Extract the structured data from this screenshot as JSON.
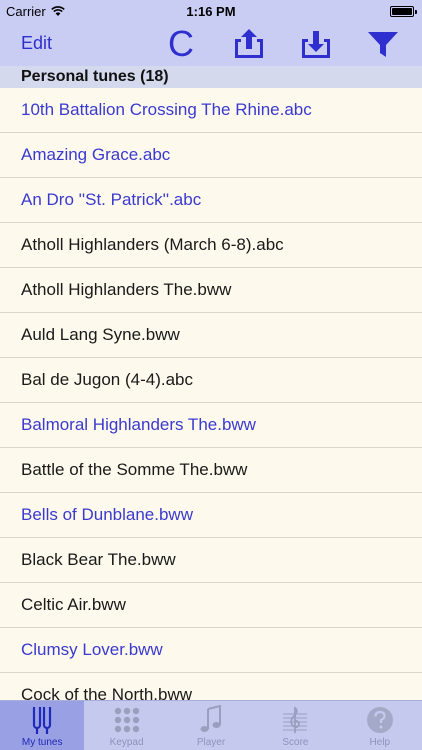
{
  "status_bar": {
    "carrier": "Carrier",
    "time": "1:16 PM"
  },
  "nav": {
    "edit_label": "Edit",
    "c_label": "C",
    "icons": [
      "upload-icon",
      "download-icon",
      "filter-icon"
    ]
  },
  "section": {
    "title": "Personal tunes (18)"
  },
  "tunes": [
    {
      "name": "10th Battalion Crossing The Rhine.abc",
      "color": "#3a3ad0"
    },
    {
      "name": "Amazing Grace.abc",
      "color": "#3a3ad0"
    },
    {
      "name": "An Dro ''St. Patrick''.abc",
      "color": "#3a3ad0"
    },
    {
      "name": "Atholl Highlanders (March 6-8).abc",
      "color": "#1a1a1a"
    },
    {
      "name": "Atholl Highlanders The.bww",
      "color": "#1a1a1a"
    },
    {
      "name": "Auld Lang Syne.bww",
      "color": "#1a1a1a"
    },
    {
      "name": "Bal de Jugon (4-4).abc",
      "color": "#1a1a1a"
    },
    {
      "name": "Balmoral Highlanders The.bww",
      "color": "#3a3ad0"
    },
    {
      "name": "Battle of the Somme The.bww",
      "color": "#1a1a1a"
    },
    {
      "name": "Bells of Dunblane.bww",
      "color": "#3a3ad0"
    },
    {
      "name": "Black Bear The.bww",
      "color": "#1a1a1a"
    },
    {
      "name": "Celtic Air.bww",
      "color": "#1a1a1a"
    },
    {
      "name": "Clumsy Lover.bww",
      "color": "#3a3ad0"
    },
    {
      "name": "Cock of the North.bww",
      "color": "#1a1a1a"
    }
  ],
  "tabs": [
    {
      "label": "My tunes",
      "icon": "tuning-fork-icon",
      "active": true
    },
    {
      "label": "Keypad",
      "icon": "keypad-icon",
      "active": false
    },
    {
      "label": "Player",
      "icon": "music-note-icon",
      "active": false
    },
    {
      "label": "Score",
      "icon": "treble-clef-icon",
      "active": false
    },
    {
      "label": "Help",
      "icon": "help-icon",
      "active": false
    }
  ]
}
